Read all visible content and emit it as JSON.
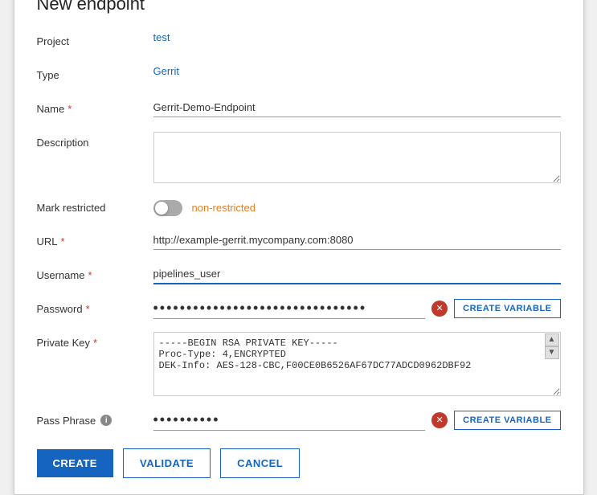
{
  "dialog": {
    "title": "New endpoint"
  },
  "fields": {
    "project_label": "Project",
    "project_value": "test",
    "type_label": "Type",
    "type_value": "Gerrit",
    "name_label": "Name",
    "name_required": "*",
    "name_value": "Gerrit-Demo-Endpoint",
    "description_label": "Description",
    "description_value": "",
    "mark_restricted_label": "Mark restricted",
    "toggle_status": "non-restricted",
    "url_label": "URL",
    "url_required": "*",
    "url_value": "http://example-gerrit.mycompany.com:8080",
    "username_label": "Username",
    "username_required": "*",
    "username_value": "pipelines_user",
    "password_label": "Password",
    "password_required": "*",
    "password_value": "••••••••••••••••••••••••••••",
    "create_variable_label": "CREATE VARIABLE",
    "private_key_label": "Private Key",
    "private_key_required": "*",
    "private_key_line1": "-----BEGIN RSA PRIVATE KEY-----",
    "private_key_line2": "Proc-Type: 4,ENCRYPTED",
    "private_key_line3": "DEK-Info: AES-128-CBC,F00CE0B6526AF67DC77ADCD0962DBF92",
    "pass_phrase_label": "Pass Phrase",
    "pass_phrase_value": "••••••",
    "create_variable_label2": "CREATE VARIABLE"
  },
  "buttons": {
    "create": "CREATE",
    "validate": "VALIDATE",
    "cancel": "CANCEL"
  }
}
